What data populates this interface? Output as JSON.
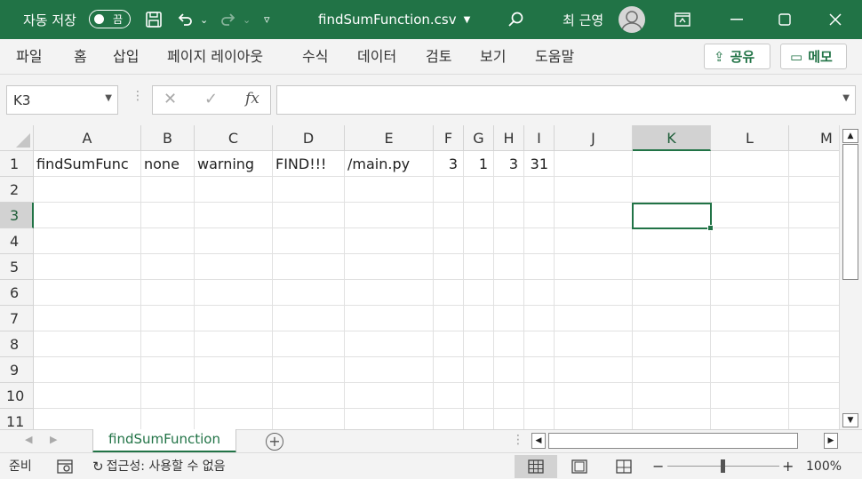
{
  "titlebar": {
    "autosave_label": "자동 저장",
    "autosave_state": "끔",
    "filename": "findSumFunction.csv",
    "user_name": "최 근영",
    "colors": {
      "accent": "#217346"
    }
  },
  "ribbon": {
    "tabs": [
      "파일",
      "홈",
      "삽입",
      "페이지 레이아웃",
      "수식",
      "데이터",
      "검토",
      "보기",
      "도움말"
    ],
    "share_label": "공유",
    "memo_label": "메모"
  },
  "formula_bar": {
    "name_box": "K3",
    "formula": ""
  },
  "grid": {
    "columns": [
      "A",
      "B",
      "C",
      "D",
      "E",
      "F",
      "G",
      "H",
      "I",
      "J",
      "K",
      "L",
      "M"
    ],
    "rows": [
      "1",
      "2",
      "3",
      "4",
      "5",
      "6",
      "7",
      "8",
      "9",
      "10",
      "11"
    ],
    "selected_column": "K",
    "selected_row": "3",
    "row1": {
      "A": "findSumFunc",
      "B": "none",
      "C": "warning",
      "D": "FIND!!!",
      "E": "/main.py",
      "F": "3",
      "G": "1",
      "H": "3",
      "I": "31"
    }
  },
  "sheets": {
    "active": "findSumFunction"
  },
  "statusbar": {
    "mode": "준비",
    "accessibility": "접근성: 사용할 수 없음",
    "zoom": "100%"
  }
}
